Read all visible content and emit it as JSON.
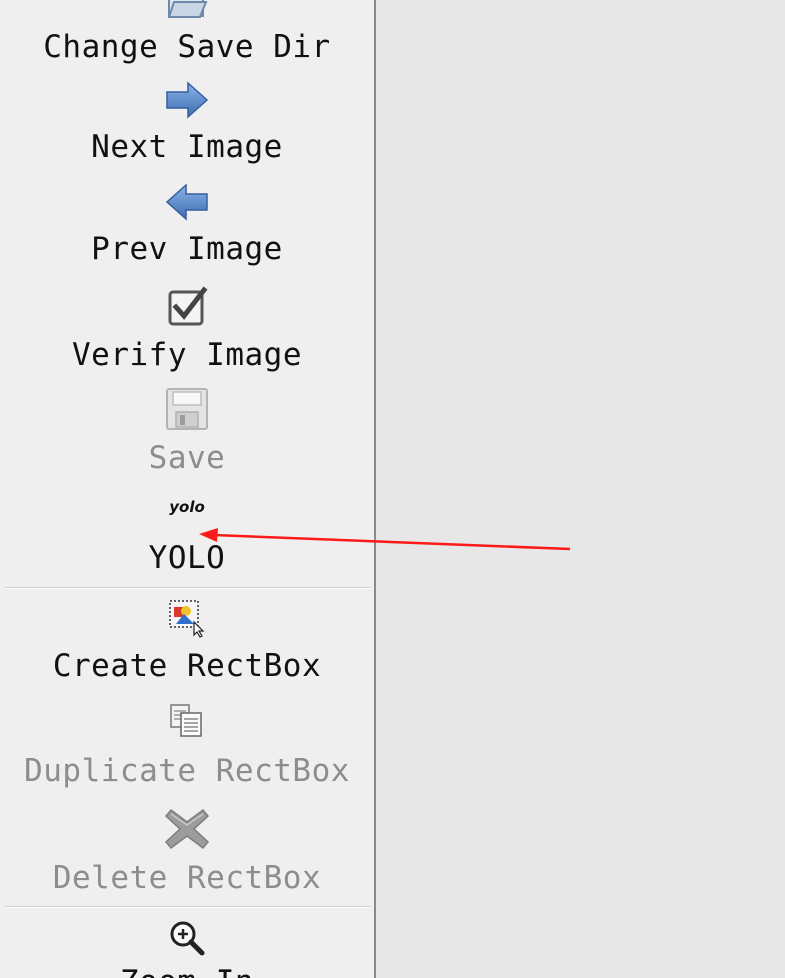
{
  "toolbar": {
    "items": [
      {
        "label": "Change Save Dir",
        "icon": "folder-open-icon",
        "enabled": true
      },
      {
        "label": "Next Image",
        "icon": "arrow-right-icon",
        "enabled": true
      },
      {
        "label": "Prev Image",
        "icon": "arrow-left-icon",
        "enabled": true
      },
      {
        "label": "Verify Image",
        "icon": "checkbox-verify-icon",
        "enabled": true
      },
      {
        "label": "Save",
        "icon": "floppy-save-icon",
        "enabled": false
      },
      {
        "label": "YOLO",
        "icon": "yolo-icon",
        "icon_text": "yolo",
        "enabled": true
      },
      {
        "label": "Create RectBox",
        "icon": "create-rectbox-icon",
        "enabled": true
      },
      {
        "label": "Duplicate RectBox",
        "icon": "duplicate-icon",
        "enabled": false
      },
      {
        "label": "Delete RectBox",
        "icon": "delete-x-icon",
        "enabled": false
      },
      {
        "label": "Zoom In",
        "icon": "zoom-in-icon",
        "enabled": true
      }
    ]
  },
  "annotation": {
    "arrow_color": "#ff1a1a"
  },
  "colors": {
    "toolbar_bg": "#efefef",
    "canvas_bg": "#e7e7e7",
    "disabled_text": "#8d8d8d",
    "arrow_blue": "#4a7fc4"
  }
}
